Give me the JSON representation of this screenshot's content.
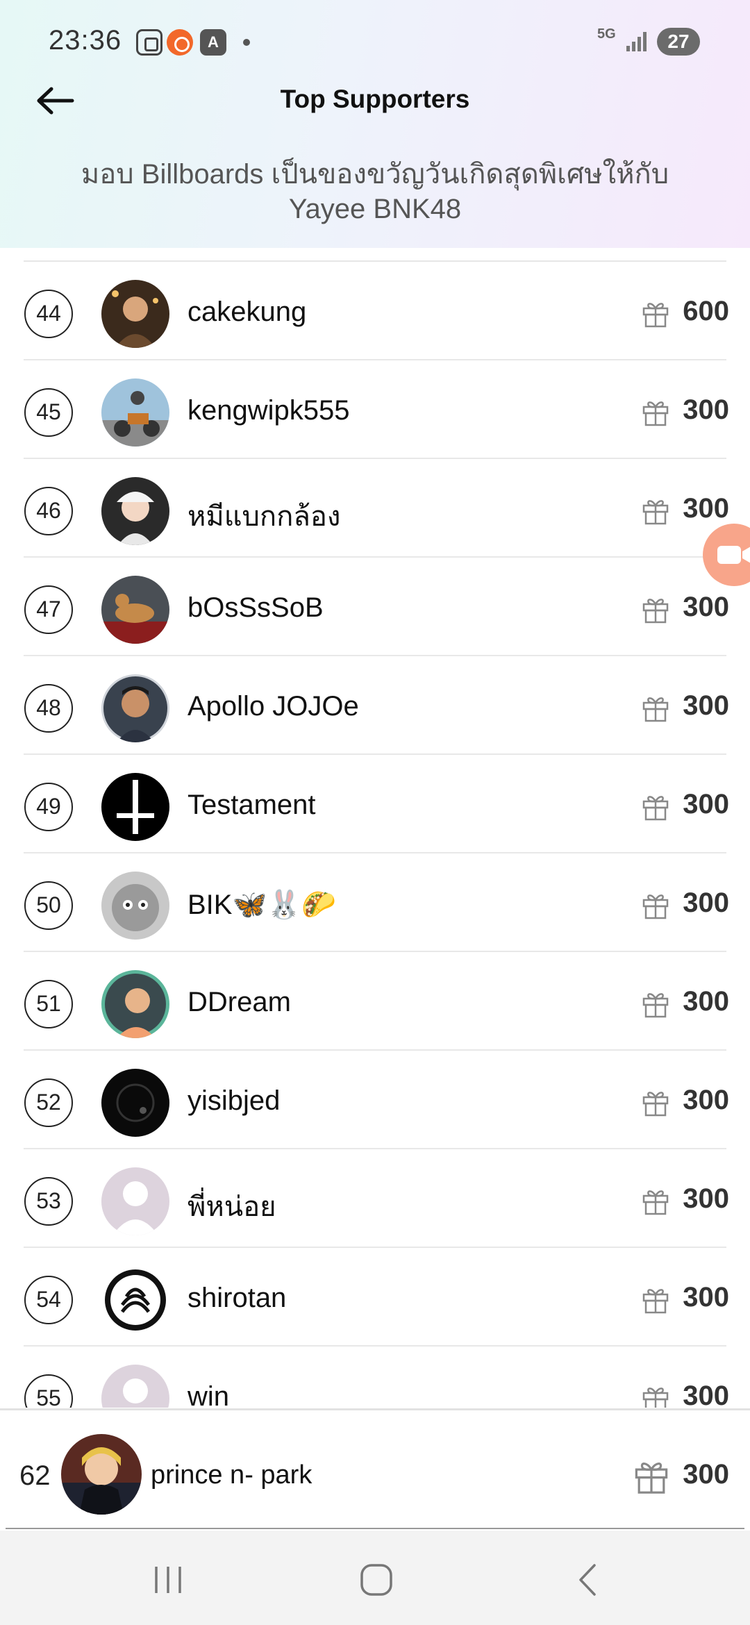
{
  "status_bar": {
    "time": "23:36",
    "network": "5G",
    "battery": "27",
    "icons": [
      "screenshot-icon",
      "screen-recorder-icon",
      "ai-icon",
      "notification-dot-icon",
      "signal-icon",
      "battery-icon"
    ]
  },
  "header": {
    "title": "Top Supporters",
    "subtitle": "มอบ  Billboards เป็นของขวัญวันเกิดสุดพิเศษให้กับ Yayee BNK48",
    "back_icon": "arrow-left-icon"
  },
  "supporters": [
    {
      "rank": "44",
      "name": "cakekung",
      "amount": "600"
    },
    {
      "rank": "45",
      "name": "kengwipk555",
      "amount": "300"
    },
    {
      "rank": "46",
      "name": "หมีแบกกล้อง",
      "amount": "300"
    },
    {
      "rank": "47",
      "name": "bOsSsSoB",
      "amount": "300"
    },
    {
      "rank": "48",
      "name": "Apollo JOJOe",
      "amount": "300"
    },
    {
      "rank": "49",
      "name": "Testament",
      "amount": "300"
    },
    {
      "rank": "50",
      "name": "BIK🦋🐰🌮",
      "amount": "300"
    },
    {
      "rank": "51",
      "name": "DDream",
      "amount": "300"
    },
    {
      "rank": "52",
      "name": " yisibjed",
      "amount": "300"
    },
    {
      "rank": "53",
      "name": "พี่หน่อย",
      "amount": "300"
    },
    {
      "rank": "54",
      "name": "shirotan",
      "amount": "300"
    },
    {
      "rank": "55",
      "name": "win",
      "amount": "300"
    }
  ],
  "current_user": {
    "rank": "62",
    "name": "prince n- park",
    "amount": "300"
  },
  "colors": {
    "accent_orange": "#f8a58a",
    "amount_text": "#333333",
    "header_gradient_start": "#e6f8f6",
    "header_gradient_end": "#f6e9fb"
  },
  "nav": {
    "icons": [
      "recent-apps-icon",
      "home-icon",
      "back-icon"
    ]
  }
}
